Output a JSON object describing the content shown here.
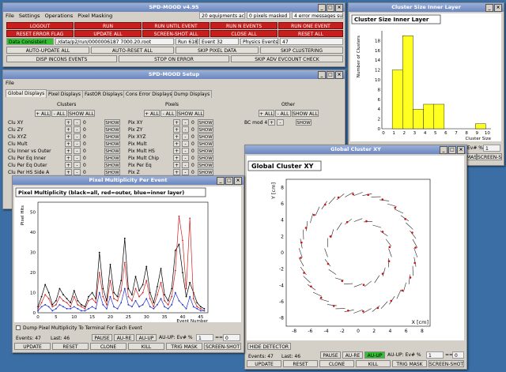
{
  "main": {
    "title": "SPD-MOOD v4.95",
    "menu": [
      "File",
      "Settings",
      "Operations",
      "Pixel Masking"
    ],
    "status": [
      "20 equipments active",
      "0 pixels masked",
      "4 error messages suppressed"
    ],
    "row1": [
      "LOGOUT",
      "RUN",
      "RUN UNTIL EVENT",
      "RUN N EVENTS",
      "RUN ONE EVENT"
    ],
    "row2": [
      "RESET ERROR FLAG",
      "UPDATE ALL",
      "SCREEN-SHOT ALL",
      "CLOSE ALL",
      "RESET ALL"
    ],
    "data_status": "Data Consistent",
    "file": "/data/p2/run/0000006187 7000.20.root",
    "run": "Run 61817",
    "event": "Event 32",
    "physics": "Physics Events:",
    "physics_val": "47",
    "row4": [
      "AUTO-UPDATE ALL",
      "AUTO-RESET ALL",
      "SKIP PIXEL DATA",
      "SKIP CLUSTERING"
    ],
    "row5": [
      "DISP INCONS EVENTS",
      "STOP ON ERROR",
      "SKIP ADV EVCOUNT CHECK"
    ]
  },
  "setup": {
    "title": "SPD-MOOD Setup",
    "menu": "File",
    "tabs": [
      "Global Displays",
      "Pixel Displays",
      "FastOR Displays",
      "Cons Error Displays",
      "Dump Displays"
    ],
    "groups": [
      "Clusters",
      "Pixels",
      "Other"
    ],
    "plus_all": "+ ALL",
    "minus_all": "- ALL",
    "show_all": "SHOW ALL",
    "show": "SHOW",
    "plus": "+",
    "minus": "-",
    "cluster_rows": [
      "Clu XY",
      "Clu ZY",
      "Clu XYZ",
      "Clu Mult",
      "Clu Inner vs Outer",
      "Clu Per Eq Inner",
      "Clu Per Eq Outer",
      "Clu Per HS Side A"
    ],
    "pixel_rows": [
      "Pix XY",
      "Pix ZY",
      "Pix XYZ",
      "Pix Mult",
      "Pix Mult HS",
      "Pix Mult Chip",
      "Pix Per Eq",
      "Pix Z"
    ],
    "zero": "0",
    "other_row": "BC mod 4"
  },
  "cluster_size": {
    "title": "Cluster Size Inner Layer",
    "plot_title": "Cluster Size Inner Layer",
    "ev_label": "Ev# %",
    "ev_val": "1",
    "screenshot": "SCREEN-SHOT",
    "mask": "MASK",
    "chart_data": {
      "type": "bar",
      "title": "Cluster Size Inner Layer",
      "xlabel": "Cluster Size",
      "ylabel": "Number of Clusters",
      "categories": [
        "0",
        "1",
        "2",
        "3",
        "4",
        "5",
        "6",
        "7",
        "8",
        "9",
        "10"
      ],
      "values": [
        0,
        12,
        19,
        4,
        5,
        5,
        0,
        0,
        0,
        1,
        0
      ],
      "x_ticks": [
        "0",
        "1",
        "2",
        "3",
        "4",
        "5",
        "6",
        "7",
        "8",
        "9",
        "10"
      ],
      "y_ticks": [
        "0",
        "2",
        "4",
        "6",
        "8",
        "10",
        "12",
        "14",
        "16",
        "18"
      ],
      "ylim": [
        0,
        20
      ]
    }
  },
  "global_xy": {
    "title": "Global Cluster XY",
    "plot_title": "Global Cluster XY",
    "hide": "HIDE DETECTOR",
    "pause": "PAUSE",
    "aure": "AU-RE",
    "auup": "AU-UP",
    "auup_ev": "AU-UP: Ev# %",
    "ev_val": "1",
    "eq": "==",
    "eq_val": "0",
    "events_label": "Events: 47",
    "last_label": "Last: 46",
    "bottom": [
      "UPDATE",
      "RESET",
      "CLONE",
      "KILL",
      "TRIG MASK",
      "SCREEN-SHOT"
    ],
    "chart_data": {
      "type": "scatter",
      "title": "Global Cluster XY",
      "xlabel": "X [cm]",
      "ylabel": "Y [cm]",
      "x_ticks": [
        "-8",
        "-6",
        "-4",
        "-2",
        "0",
        "2",
        "4",
        "6",
        "8"
      ],
      "y_ticks": [
        "-8",
        "-6",
        "-4",
        "-2",
        "0",
        "2",
        "4",
        "6",
        "8"
      ],
      "xlim": [
        -9,
        9
      ],
      "ylim": [
        -9,
        9
      ],
      "rings_radius": [
        4,
        7.2
      ],
      "series": [
        {
          "points_angle_inner": [
            10,
            40,
            75,
            110,
            150,
            200,
            240,
            280,
            320,
            345
          ]
        },
        {
          "points_angle_outer": [
            5,
            20,
            35,
            50,
            65,
            80,
            95,
            110,
            125,
            140,
            155,
            170,
            185,
            200,
            215,
            230,
            245,
            260,
            275,
            290,
            305,
            320,
            335,
            350
          ]
        }
      ]
    }
  },
  "pixel_mult": {
    "title": "Pixel Multiplicity Per Event",
    "plot_title": "Pixel Multiplicity (black=all, red=outer, blue=inner layer)",
    "dump_label": "Dump Pixel Multiplicity To Terminal For Each Event",
    "pause": "PAUSE",
    "aure": "AU-RE",
    "auup": "AU-UP",
    "auup_ev": "AU-UP: Ev# %",
    "ev_val": "1",
    "eq": "==",
    "eq_val": "0",
    "events_label": "Events: 47",
    "last_label": "Last: 46",
    "bottom": [
      "UPDATE",
      "RESET",
      "CLONE",
      "KILL",
      "TRIG MASK",
      "SCREEN-SHOT"
    ],
    "chart_data": {
      "type": "line",
      "title": "Pixel Multiplicity (black=all, red=outer, blue=inner layer)",
      "xlabel": "Event Number",
      "ylabel": "Pixel Hits",
      "x_ticks": [
        "0",
        "5",
        "10",
        "15",
        "20",
        "25",
        "30",
        "35",
        "40",
        "45"
      ],
      "y_ticks": [
        "0",
        "10",
        "20",
        "30",
        "40",
        "50"
      ],
      "xlim": [
        0,
        47
      ],
      "ylim": [
        0,
        55
      ],
      "series": [
        {
          "name": "all",
          "color": "#000000",
          "values": [
            3,
            8,
            14,
            10,
            4,
            6,
            12,
            9,
            7,
            5,
            11,
            6,
            4,
            3,
            8,
            10,
            7,
            30,
            12,
            6,
            24,
            10,
            8,
            16,
            37,
            12,
            9,
            18,
            11,
            14,
            23,
            10,
            5,
            13,
            22,
            9,
            6,
            12,
            31,
            34,
            20,
            8,
            15,
            10,
            5,
            3,
            2
          ]
        },
        {
          "name": "outer",
          "color": "#d02020",
          "values": [
            2,
            5,
            9,
            7,
            3,
            4,
            8,
            6,
            5,
            3,
            8,
            4,
            3,
            2,
            6,
            7,
            5,
            20,
            8,
            4,
            16,
            7,
            6,
            11,
            25,
            8,
            6,
            12,
            8,
            10,
            16,
            7,
            3,
            9,
            15,
            6,
            4,
            8,
            21,
            48,
            36,
            12,
            47,
            7,
            3,
            2,
            1
          ]
        },
        {
          "name": "inner",
          "color": "#2030d0",
          "values": [
            1,
            3,
            4,
            3,
            1,
            2,
            4,
            3,
            2,
            2,
            3,
            2,
            1,
            1,
            2,
            3,
            2,
            10,
            4,
            2,
            8,
            3,
            2,
            5,
            12,
            4,
            3,
            6,
            3,
            4,
            7,
            3,
            2,
            4,
            7,
            3,
            2,
            4,
            10,
            6,
            4,
            2,
            8,
            3,
            2,
            1,
            1
          ]
        }
      ]
    }
  }
}
